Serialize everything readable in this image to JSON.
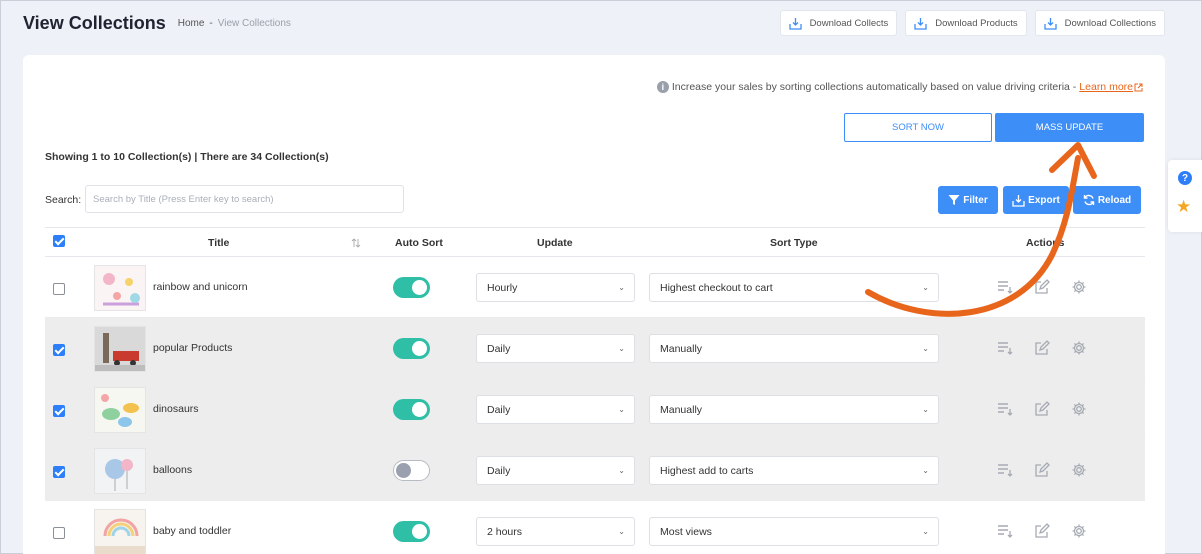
{
  "header": {
    "title": "View Collections",
    "breadcrumb": {
      "home": "Home",
      "separator": "-",
      "current": "View Collections"
    },
    "downloads": [
      "Download Collects",
      "Download Products",
      "Download Collections"
    ]
  },
  "info": {
    "text": "Increase your sales by sorting collections automatically based on value driving criteria -",
    "link": "Learn more"
  },
  "actions": {
    "sort_now": "SORT NOW",
    "mass_update": "MASS UPDATE"
  },
  "summary": "Showing 1 to 10 Collection(s) | There are 34 Collection(s)",
  "search": {
    "label": "Search:",
    "placeholder": "Search by Title (Press Enter key to search)"
  },
  "toolbar": {
    "filter": "Filter",
    "export": "Export",
    "reload": "Reload"
  },
  "table": {
    "columns": {
      "title": "Title",
      "auto_sort": "Auto Sort",
      "update": "Update",
      "sort_type": "Sort Type",
      "actions": "Actions"
    },
    "rows": [
      {
        "title": "rainbow and unicorn",
        "checked": false,
        "auto_sort": true,
        "update": "Hourly",
        "sort_type": "Highest checkout to cart"
      },
      {
        "title": "popular Products",
        "checked": true,
        "auto_sort": true,
        "update": "Daily",
        "sort_type": "Manually"
      },
      {
        "title": "dinosaurs",
        "checked": true,
        "auto_sort": true,
        "update": "Daily",
        "sort_type": "Manually"
      },
      {
        "title": "balloons",
        "checked": true,
        "auto_sort": false,
        "update": "Daily",
        "sort_type": "Highest add to carts"
      },
      {
        "title": "baby and toddler",
        "checked": false,
        "auto_sort": true,
        "update": "2 hours",
        "sort_type": "Most views"
      }
    ]
  },
  "colors": {
    "primary": "#3e8ef7",
    "toggle_on": "#2fbfa6",
    "arrow": "#e8651c",
    "link": "#e8651c"
  }
}
